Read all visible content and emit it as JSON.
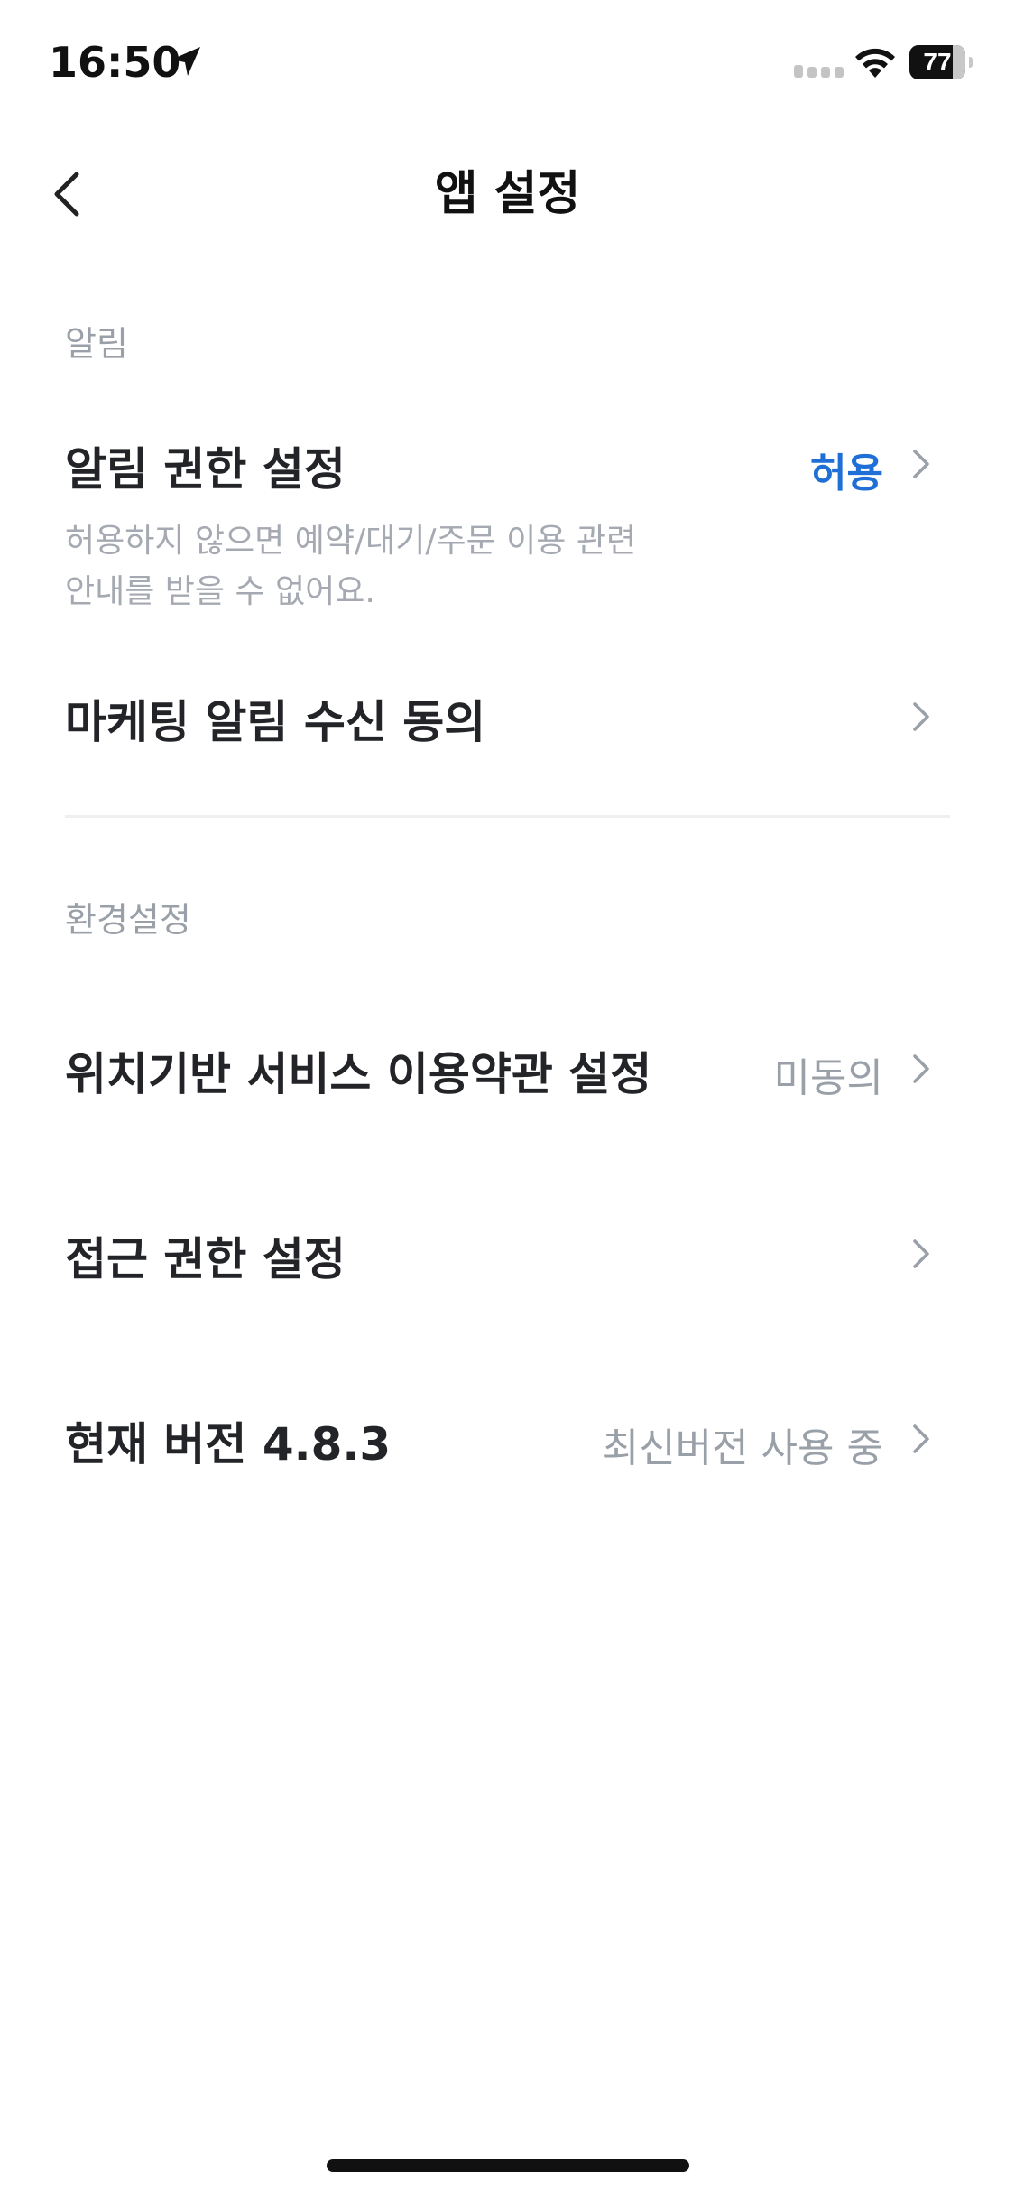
{
  "status_bar": {
    "time": "16:50",
    "battery_level": "77",
    "icons": [
      "location-arrow-icon",
      "cellular-signal-icon",
      "wifi-icon",
      "battery-icon"
    ]
  },
  "nav": {
    "title": "앱 설정",
    "back_icon": "chevron-left-icon"
  },
  "sections": {
    "notifications": {
      "header": "알림",
      "permission": {
        "label": "알림 권한 설정",
        "value": "허용",
        "desc_line1": "허용하지 않으면 예약/대기/주문 이용 관련",
        "desc_line2": "안내를 받을 수 없어요."
      },
      "marketing": {
        "label": "마케팅 알림 수신 동의"
      }
    },
    "preferences": {
      "header": "환경설정",
      "location_terms": {
        "label": "위치기반 서비스 이용약관 설정",
        "value": "미동의"
      },
      "access_permission": {
        "label": "접근 권한 설정"
      },
      "version": {
        "label": "현재 버전 4.8.3",
        "value": "최신버전 사용 중"
      }
    }
  },
  "colors": {
    "accent": "#1f6fd6",
    "muted": "#9aa0a8",
    "text": "#222428",
    "divider": "#eeeff1"
  }
}
